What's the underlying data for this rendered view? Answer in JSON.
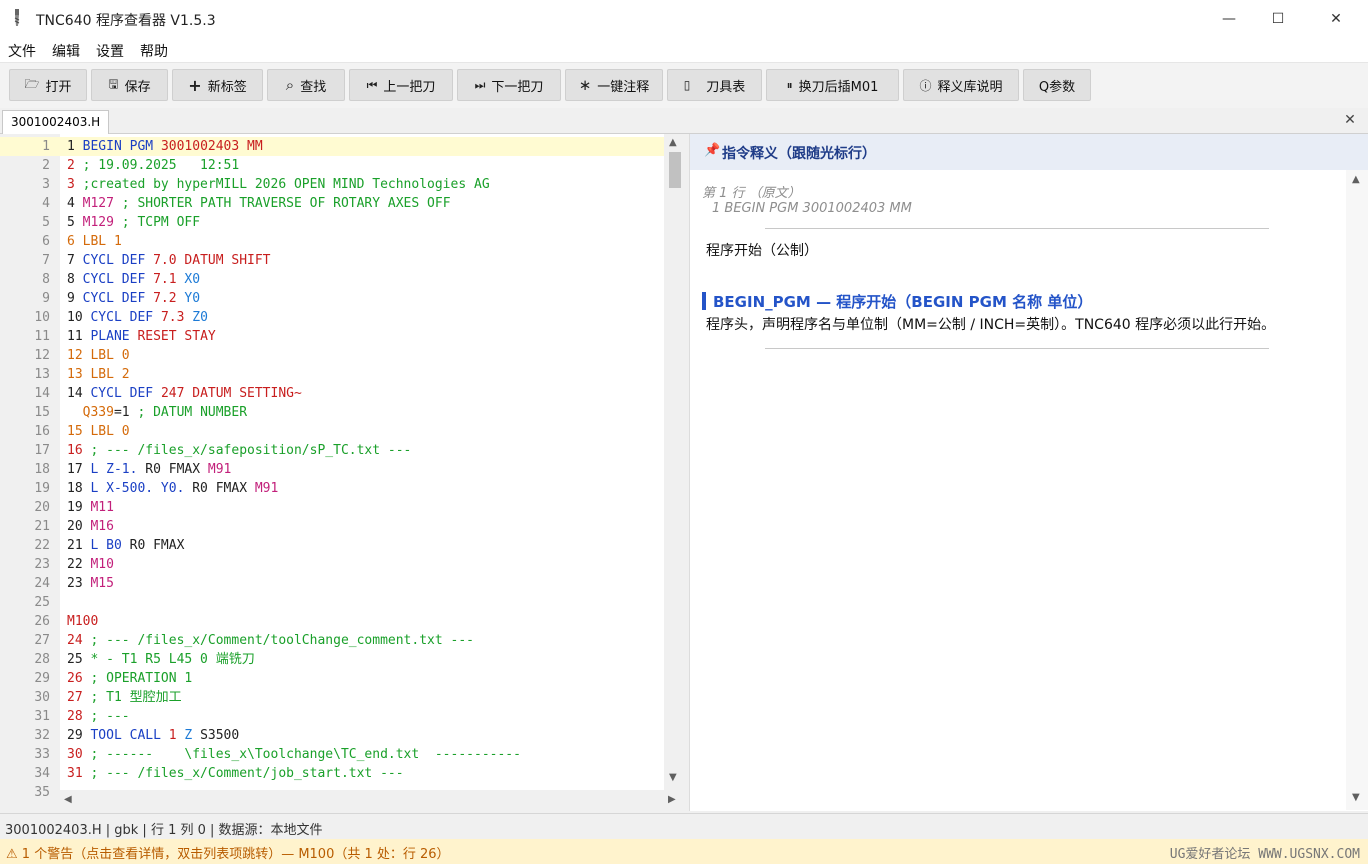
{
  "window": {
    "title": "TNC640 程序查看器 V1.5.3",
    "minimize": "—",
    "maximize": "☐",
    "close": "✕"
  },
  "menu": [
    "文件",
    "编辑",
    "设置",
    "帮助"
  ],
  "toolbar": [
    {
      "icon": "folder-open-icon",
      "glyph": "🗁",
      "label": "打开"
    },
    {
      "icon": "save-icon",
      "glyph": "🖫",
      "label": "保存"
    },
    {
      "icon": "plus-icon",
      "glyph": "+",
      "label": "新标签"
    },
    {
      "icon": "search-icon",
      "glyph": "⌕",
      "label": "查找"
    },
    {
      "icon": "prev-tool-icon",
      "glyph": "⏮",
      "label": "上一把刀"
    },
    {
      "icon": "next-tool-icon",
      "glyph": "⏭",
      "label": "下一把刀"
    },
    {
      "icon": "asterisk-icon",
      "glyph": "∗",
      "label": "一键注释"
    },
    {
      "icon": "tool-icon",
      "glyph": "▯",
      "label": "刀具表"
    },
    {
      "icon": "pause-icon",
      "glyph": "⏸",
      "label": "换刀后插M01"
    },
    {
      "icon": "info-icon",
      "glyph": "ⓘ",
      "label": "释义库说明"
    },
    {
      "icon": "",
      "glyph": "",
      "label": "Q参数"
    }
  ],
  "tab": {
    "label": "3001002403.H",
    "close": "✕"
  },
  "editor": {
    "lines": [
      [
        [
          "1 ",
          "dk"
        ],
        [
          "BEGIN PGM ",
          "k"
        ],
        [
          "3001002403 MM",
          "n"
        ]
      ],
      [
        [
          "2 ",
          "n"
        ],
        [
          "; 19.09.2025   12:51",
          "c"
        ]
      ],
      [
        [
          "3 ",
          "n"
        ],
        [
          ";created by hyperMILL 2026 OPEN MIND Technologies AG",
          "c"
        ]
      ],
      [
        [
          "4 ",
          "dk"
        ],
        [
          "M127",
          "m"
        ],
        [
          " ; SHORTER PATH TRAVERSE OF ROTARY AXES OFF",
          "c"
        ]
      ],
      [
        [
          "5 ",
          "dk"
        ],
        [
          "M129",
          "m"
        ],
        [
          " ; TCPM OFF",
          "c"
        ]
      ],
      [
        [
          "6 ",
          "lb"
        ],
        [
          "LBL 1",
          "lb"
        ]
      ],
      [
        [
          "7 ",
          "dk"
        ],
        [
          "CYCL DEF ",
          "k"
        ],
        [
          "7.0 DATUM SHIFT",
          "n"
        ]
      ],
      [
        [
          "8 ",
          "dk"
        ],
        [
          "CYCL DEF ",
          "k"
        ],
        [
          "7.1 ",
          "n"
        ],
        [
          "X0",
          "bl"
        ]
      ],
      [
        [
          "9 ",
          "dk"
        ],
        [
          "CYCL DEF ",
          "k"
        ],
        [
          "7.2 ",
          "n"
        ],
        [
          "Y0",
          "bl"
        ]
      ],
      [
        [
          "10 ",
          "dk"
        ],
        [
          "CYCL DEF ",
          "k"
        ],
        [
          "7.3 ",
          "n"
        ],
        [
          "Z0",
          "bl"
        ]
      ],
      [
        [
          "11 ",
          "dk"
        ],
        [
          "PLANE ",
          "k"
        ],
        [
          "RESET STAY",
          "n"
        ]
      ],
      [
        [
          "12 ",
          "lb"
        ],
        [
          "LBL 0",
          "lb"
        ]
      ],
      [
        [
          "13 ",
          "lb"
        ],
        [
          "LBL 2",
          "lb"
        ]
      ],
      [
        [
          "14 ",
          "dk"
        ],
        [
          "CYCL DEF ",
          "k"
        ],
        [
          "247 DATUM SETTING~",
          "n"
        ]
      ],
      [
        [
          "  ",
          "dk"
        ],
        [
          "Q339",
          "lb"
        ],
        [
          "=1 ",
          "dk"
        ],
        [
          "; DATUM NUMBER",
          "c"
        ]
      ],
      [
        [
          "15 ",
          "lb"
        ],
        [
          "LBL 0",
          "lb"
        ]
      ],
      [
        [
          "16 ",
          "n"
        ],
        [
          "; --- /files_x/safeposition/sP_TC.txt ---",
          "c"
        ]
      ],
      [
        [
          "17 ",
          "dk"
        ],
        [
          "L Z-1. ",
          "k"
        ],
        [
          "R0 FMAX ",
          "dk"
        ],
        [
          "M91",
          "m"
        ]
      ],
      [
        [
          "18 ",
          "dk"
        ],
        [
          "L X-500. Y0. ",
          "k"
        ],
        [
          "R0 FMAX ",
          "dk"
        ],
        [
          "M91",
          "m"
        ]
      ],
      [
        [
          "19 ",
          "dk"
        ],
        [
          "M11",
          "m"
        ]
      ],
      [
        [
          "20 ",
          "dk"
        ],
        [
          "M16",
          "m"
        ]
      ],
      [
        [
          "21 ",
          "dk"
        ],
        [
          "L B0 ",
          "k"
        ],
        [
          "R0 FMAX",
          "dk"
        ]
      ],
      [
        [
          "22 ",
          "dk"
        ],
        [
          "M10",
          "m"
        ]
      ],
      [
        [
          "23 ",
          "dk"
        ],
        [
          "M15",
          "m"
        ]
      ],
      [],
      [
        [
          "M100",
          "n"
        ]
      ],
      [
        [
          "24 ",
          "n"
        ],
        [
          "; --- /files_x/Comment/toolChange_comment.txt ---",
          "c"
        ]
      ],
      [
        [
          "25 ",
          "dk"
        ],
        [
          "* - T1 R5 L45 0 端铣刀",
          "c"
        ]
      ],
      [
        [
          "26 ",
          "n"
        ],
        [
          "; OPERATION 1",
          "c"
        ]
      ],
      [
        [
          "27 ",
          "n"
        ],
        [
          "; T1 型腔加工",
          "c"
        ]
      ],
      [
        [
          "28 ",
          "n"
        ],
        [
          "; ---",
          "c"
        ]
      ],
      [
        [
          "29 ",
          "dk"
        ],
        [
          "TOOL CALL ",
          "k"
        ],
        [
          "1 ",
          "n"
        ],
        [
          "Z ",
          "bl"
        ],
        [
          "S3500",
          "dk"
        ]
      ],
      [
        [
          "30 ",
          "n"
        ],
        [
          "; ------    \\files_x\\Toolchange\\TC_end.txt  -----------",
          "c"
        ]
      ],
      [
        [
          "31 ",
          "n"
        ],
        [
          "; --- /files_x/Comment/job_start.txt ---",
          "c"
        ]
      ],
      []
    ]
  },
  "panel": {
    "title": "指令释义（跟随光标行）",
    "line_meta": "第 1 行   （原文）",
    "original": "1 BEGIN PGM 3001002403 MM",
    "summary": "程序开始（公制）",
    "cmd_title": "BEGIN_PGM — 程序开始（BEGIN PGM 名称 单位）",
    "cmd_desc": "程序头，声明程序名与单位制（MM=公制 / INCH=英制）。TNC640 程序必须以此行开始。"
  },
  "status": {
    "text": "3001002403.H  |  gbk  |  行 1 列 0  |  数据源：本地文件"
  },
  "warning": {
    "text": "⚠ 1 个警告（点击查看详情，双击列表项跳转）— M100（共 1 处：行 26）",
    "watermark": "UG爱好者论坛 WWW.UGSNX.COM"
  },
  "colors": {
    "keyword": "#1a3fc4",
    "number": "#c81e1e",
    "comment": "#1aa02a",
    "mcode": "#c21f7a",
    "label": "#d46a0a",
    "axis": "#1c7ad6",
    "accent": "#2454c8",
    "warning_bg": "#fff3cd"
  }
}
